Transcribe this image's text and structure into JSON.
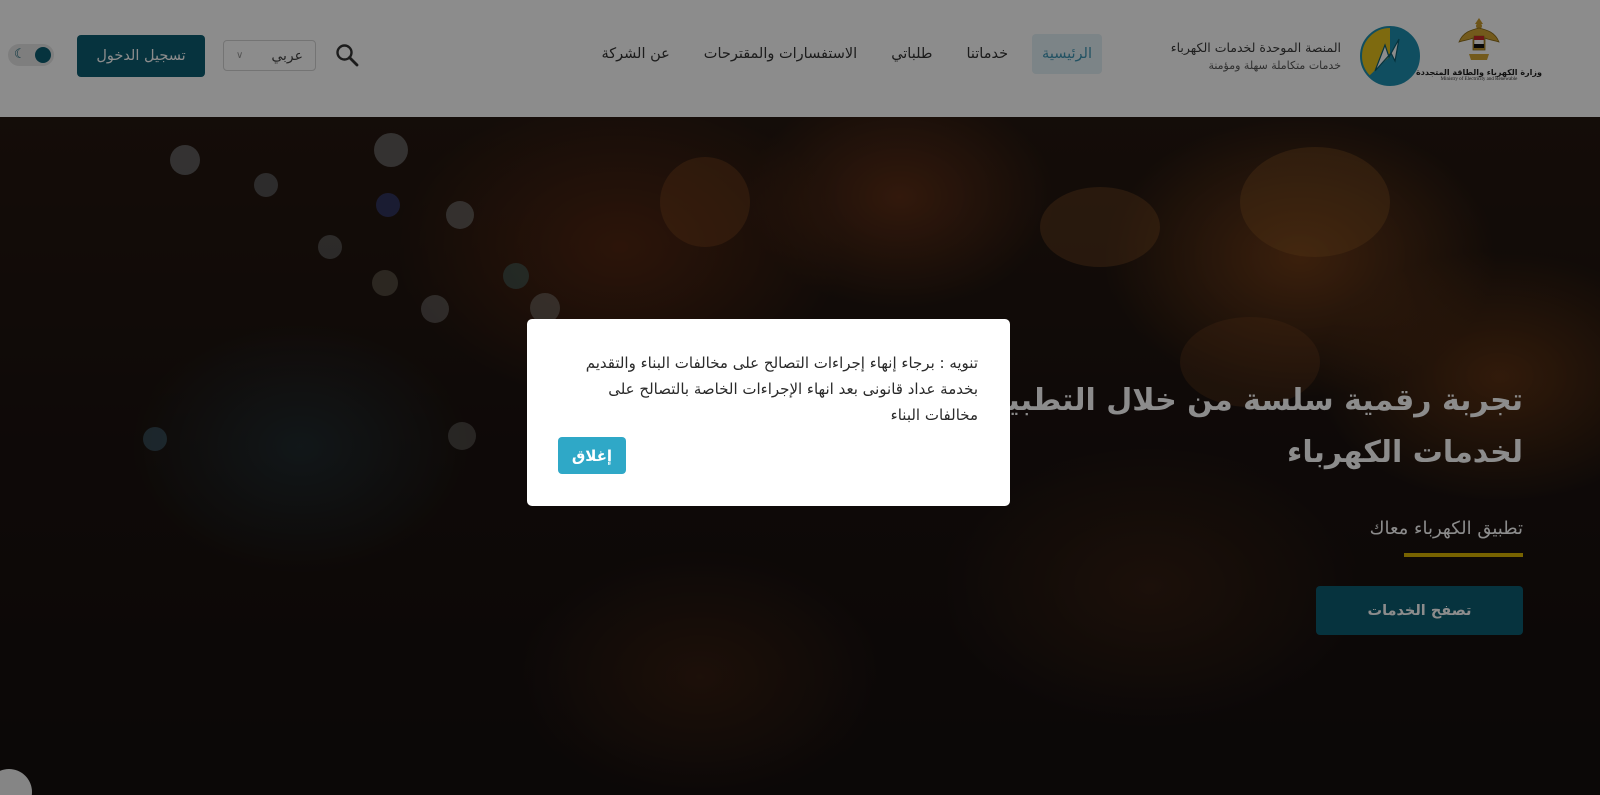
{
  "header": {
    "ministry_logo": {
      "icon": "egypt-eagle-emblem",
      "arabic_text": "وزارة الكهرباء والطاقة المتجددة",
      "english_text": "Ministry of Electricity and Renewable"
    },
    "platform_logo": {
      "icon": "lightning-bolt-circle"
    },
    "platform_title": "المنصة الموحدة لخدمات الكهرباء",
    "platform_tagline": "خدمات متكاملة سهلة ومؤمنة",
    "nav": [
      {
        "label": "الرئيسية",
        "active": true
      },
      {
        "label": "خدماتنا",
        "active": false
      },
      {
        "label": "طلباتي",
        "active": false
      },
      {
        "label": "الاستفسارات والمقترحات",
        "active": false
      },
      {
        "label": "عن الشركة",
        "active": false
      }
    ],
    "search_icon": "search-icon",
    "language_select": {
      "value": "عربي",
      "icon": "chevron-down-icon"
    },
    "login_label": "تسجيل الدخول",
    "theme_toggle": {
      "icon": "moon-icon"
    }
  },
  "hero": {
    "headline": "تجربة رقمية سلسة من خلال التطبيق لخدمات الكهرباء",
    "subheading": "تطبيق الكهرباء معاك",
    "browse_label": "تصفح الخدمات"
  },
  "modal": {
    "message": "تنويه : برجاء إنهاء إجراءات التصالح على مخالفات البناء والتقديم بخدمة عداد قانونى بعد انهاء الإجراءات الخاصة بالتصالح على مخالفات البناء",
    "close_label": "إغلاق"
  },
  "colors": {
    "primary": "#0c5d71",
    "accent_underline": "#d9b500",
    "close_button": "#2fa8c7",
    "nav_active_bg": "#e2f0f6",
    "nav_active_text": "#3f95b4"
  }
}
